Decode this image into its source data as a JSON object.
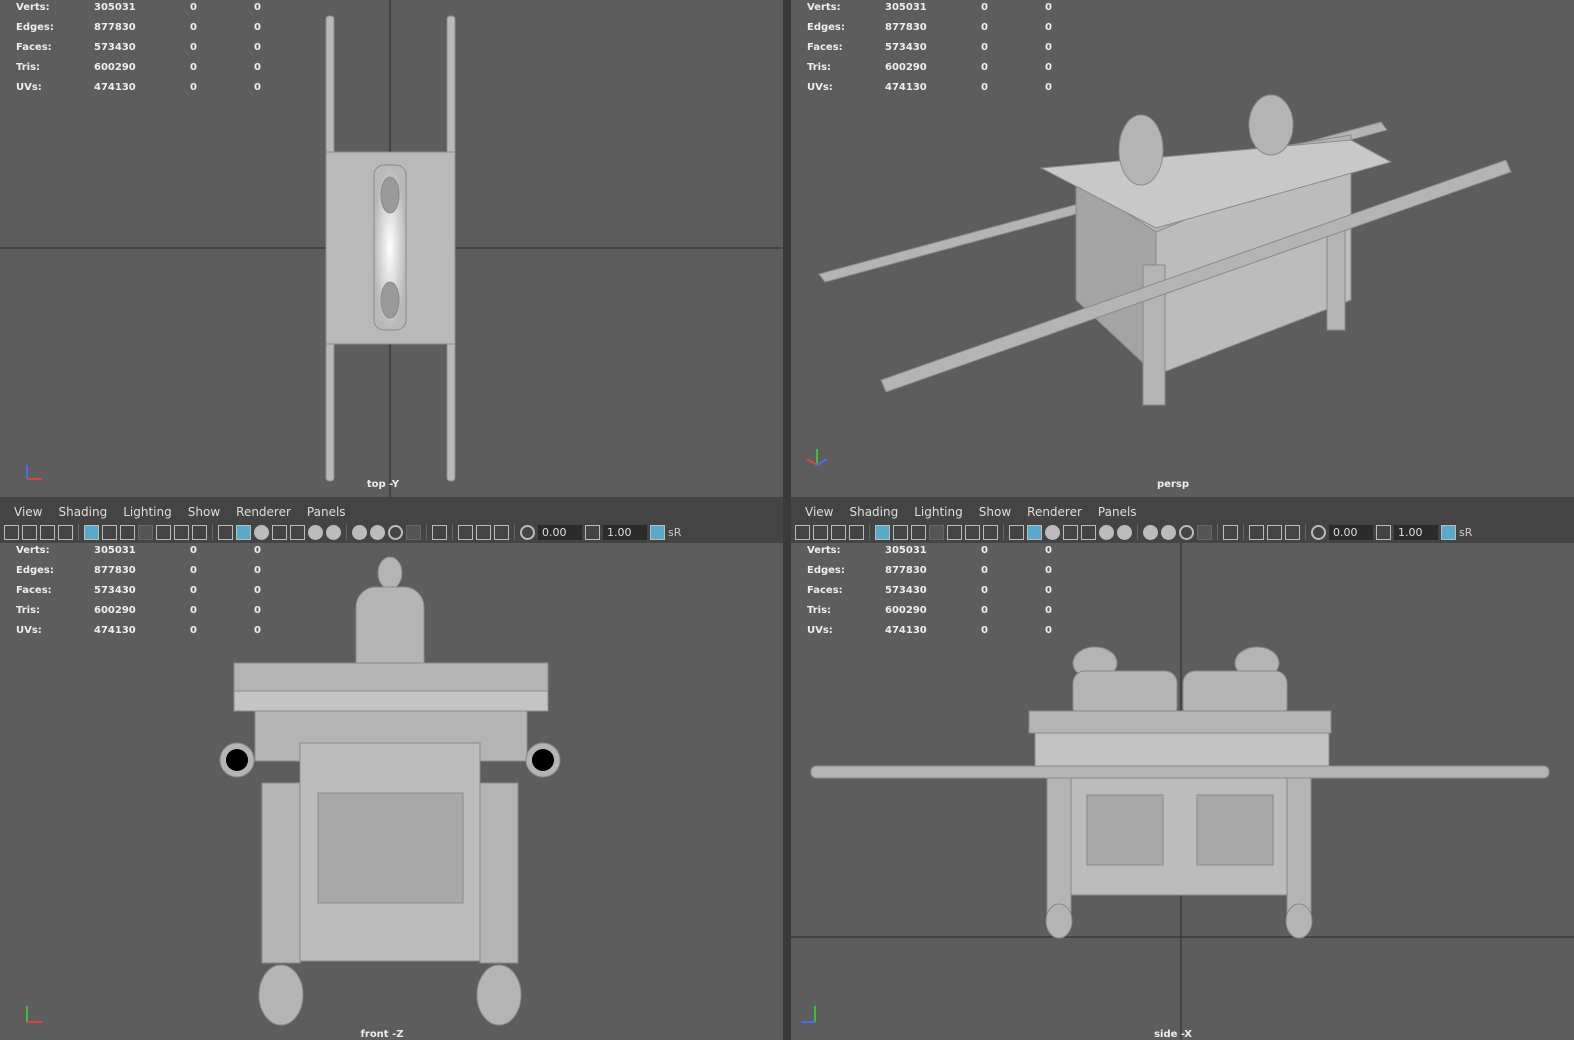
{
  "viewports": [
    {
      "camera": "top -Y",
      "hud": {
        "rows": [
          {
            "label": "Verts:",
            "v1": "305031",
            "v2": "0",
            "v3": "0"
          },
          {
            "label": "Edges:",
            "v1": "877830",
            "v2": "0",
            "v3": "0"
          },
          {
            "label": "Faces:",
            "v1": "573430",
            "v2": "0",
            "v3": "0"
          },
          {
            "label": "Tris:",
            "v1": "600290",
            "v2": "0",
            "v3": "0"
          },
          {
            "label": "UVs:",
            "v1": "474130",
            "v2": "0",
            "v3": "0"
          }
        ]
      }
    },
    {
      "camera": "persp",
      "hud": {
        "rows": [
          {
            "label": "Verts:",
            "v1": "305031",
            "v2": "0",
            "v3": "0"
          },
          {
            "label": "Edges:",
            "v1": "877830",
            "v2": "0",
            "v3": "0"
          },
          {
            "label": "Faces:",
            "v1": "573430",
            "v2": "0",
            "v3": "0"
          },
          {
            "label": "Tris:",
            "v1": "600290",
            "v2": "0",
            "v3": "0"
          },
          {
            "label": "UVs:",
            "v1": "474130",
            "v2": "0",
            "v3": "0"
          }
        ]
      }
    },
    {
      "camera": "front -Z",
      "hud": {
        "rows": [
          {
            "label": "Verts:",
            "v1": "305031",
            "v2": "0",
            "v3": "0"
          },
          {
            "label": "Edges:",
            "v1": "877830",
            "v2": "0",
            "v3": "0"
          },
          {
            "label": "Faces:",
            "v1": "573430",
            "v2": "0",
            "v3": "0"
          },
          {
            "label": "Tris:",
            "v1": "600290",
            "v2": "0",
            "v3": "0"
          },
          {
            "label": "UVs:",
            "v1": "474130",
            "v2": "0",
            "v3": "0"
          }
        ]
      }
    },
    {
      "camera": "side -X",
      "hud": {
        "rows": [
          {
            "label": "Verts:",
            "v1": "305031",
            "v2": "0",
            "v3": "0"
          },
          {
            "label": "Edges:",
            "v1": "877830",
            "v2": "0",
            "v3": "0"
          },
          {
            "label": "Faces:",
            "v1": "573430",
            "v2": "0",
            "v3": "0"
          },
          {
            "label": "Tris:",
            "v1": "600290",
            "v2": "0",
            "v3": "0"
          },
          {
            "label": "UVs:",
            "v1": "474130",
            "v2": "0",
            "v3": "0"
          }
        ]
      }
    }
  ],
  "panel_menu": [
    "View",
    "Shading",
    "Lighting",
    "Show",
    "Renderer",
    "Panels"
  ],
  "toolbar": {
    "value_a": "0.00",
    "value_b": "1.00",
    "srgb_label": "sR"
  },
  "colors": {
    "viewport_bg": "#5d5d5d",
    "model": "#b4b4b4",
    "accent": "#5aa9c9"
  }
}
